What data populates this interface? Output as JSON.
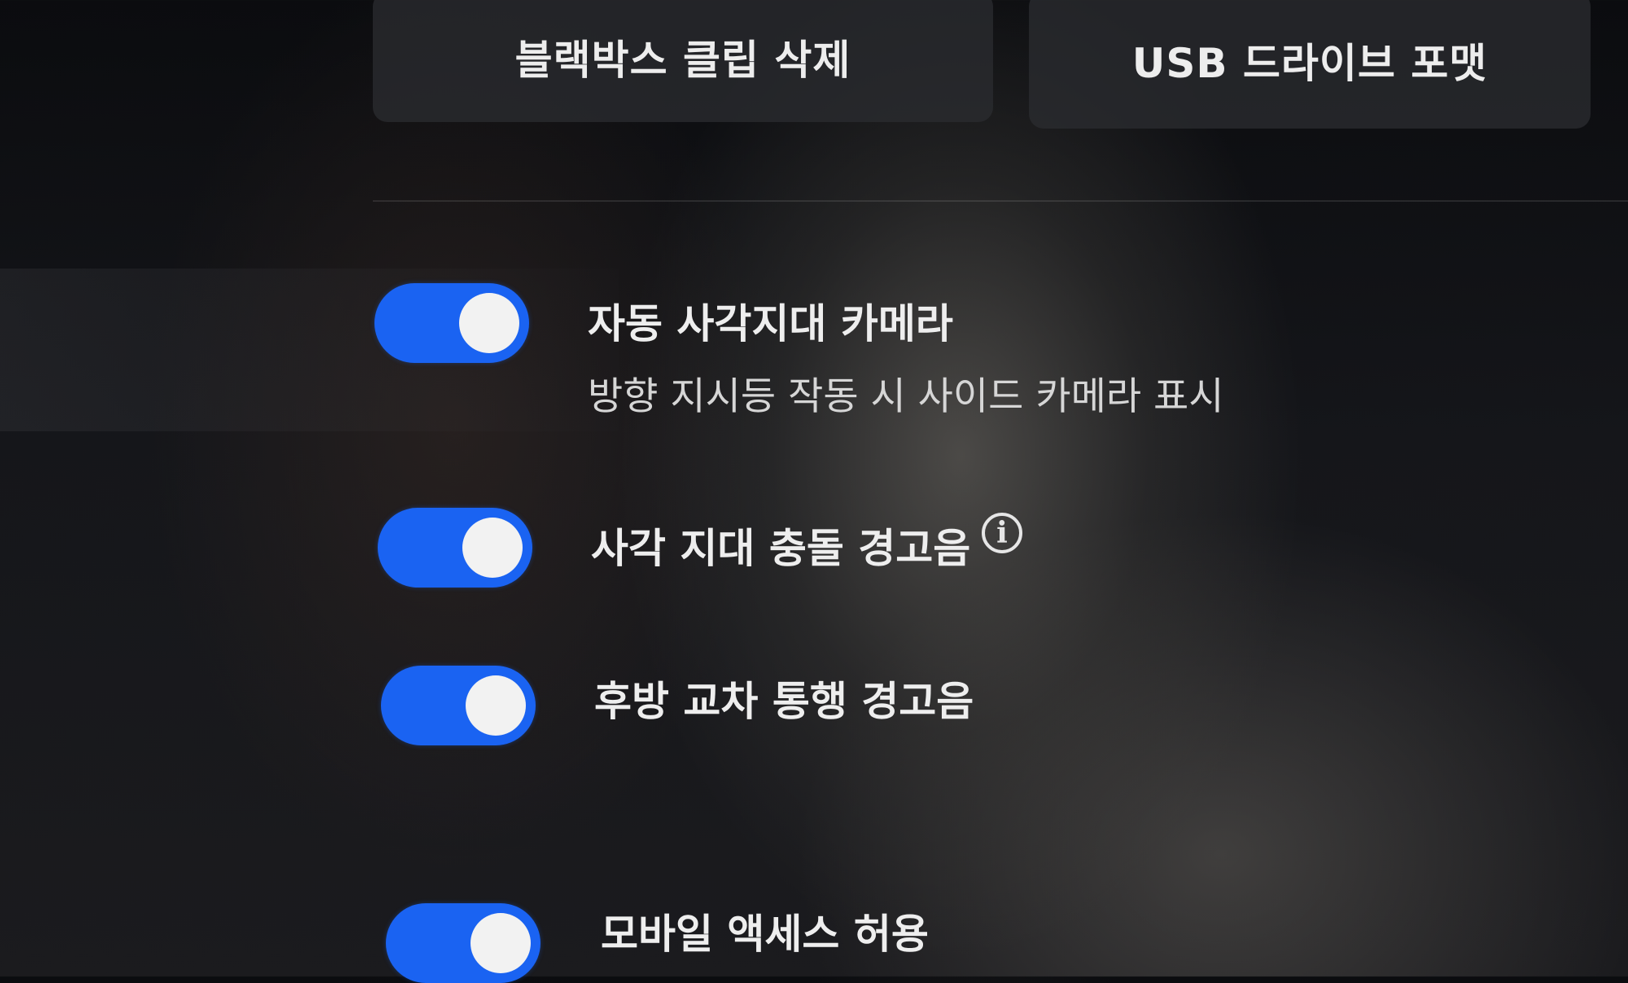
{
  "top_buttons": {
    "delete_clips_label": "블랙박스 클립 삭제",
    "format_usb_label": "USB 드라이브 포맷"
  },
  "settings": [
    {
      "label": "자동 사각지대 카메라",
      "description": "방향 지시등 작동 시 사이드 카메라 표시",
      "enabled": true
    },
    {
      "label": "사각 지대 충돌 경고음",
      "has_info_icon": true,
      "enabled": true
    },
    {
      "label": "후방 교차 통행 경고음",
      "enabled": true
    },
    {
      "label": "모바일 액세스 허용",
      "enabled": true
    }
  ],
  "icons": {
    "info": "info-icon"
  },
  "colors": {
    "toggle_on": "#1a63f2",
    "knob": "#f2f2f2",
    "text": "#eeeeee",
    "button_bg": "#2a2b30"
  }
}
